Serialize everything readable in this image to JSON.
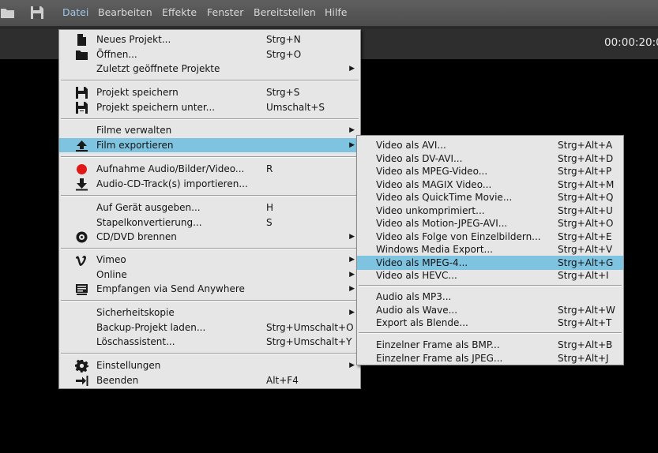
{
  "menubar": {
    "items": [
      "Datei",
      "Bearbeiten",
      "Effekte",
      "Fenster",
      "Bereitstellen",
      "Hilfe"
    ],
    "active_color": "#9fc7ea"
  },
  "timecode": "00:00:20:0",
  "file_menu": {
    "rows": [
      {
        "label": "Neues Projekt...",
        "shortcut": "Strg+N",
        "icon": "new-document-icon"
      },
      {
        "label": "Öffnen...",
        "shortcut": "Strg+O",
        "icon": "folder-icon"
      },
      {
        "label": "Zuletzt geöffnete Projekte",
        "submenu": true
      },
      {
        "label": "Projekt speichern",
        "shortcut": "Strg+S",
        "icon": "save-icon"
      },
      {
        "label": "Projekt speichern unter...",
        "shortcut": "Umschalt+S",
        "icon": "save-as-icon"
      },
      {
        "label": "Filme verwalten",
        "submenu": true
      },
      {
        "label": "Film exportieren",
        "submenu": true,
        "icon": "export-upload-icon",
        "highlighted": true
      },
      {
        "label": "Aufnahme Audio/Bilder/Video...",
        "shortcut": "R",
        "icon": "record-icon"
      },
      {
        "label": "Audio-CD-Track(s) importieren...",
        "icon": "download-import-icon"
      },
      {
        "label": "Auf Gerät ausgeben...",
        "shortcut": "H"
      },
      {
        "label": "Stapelkonvertierung...",
        "shortcut": "S"
      },
      {
        "label": "CD/DVD brennen",
        "submenu": true,
        "icon": "disc-icon"
      },
      {
        "label": "Vimeo",
        "submenu": true,
        "icon": "vimeo-icon"
      },
      {
        "label": "Online",
        "submenu": true
      },
      {
        "label": "Empfangen via Send Anywhere",
        "submenu": true,
        "icon": "send-anywhere-icon"
      },
      {
        "label": "Sicherheitskopie",
        "submenu": true
      },
      {
        "label": "Backup-Projekt laden...",
        "shortcut": "Strg+Umschalt+O"
      },
      {
        "label": "Löschassistent...",
        "shortcut": "Strg+Umschalt+Y"
      },
      {
        "label": "Einstellungen",
        "submenu": true,
        "icon": "gear-icon"
      },
      {
        "label": "Beenden",
        "shortcut": "Alt+F4",
        "icon": "exit-icon"
      }
    ]
  },
  "export_menu": {
    "rows": [
      {
        "label": "Video als AVI...",
        "shortcut": "Strg+Alt+A"
      },
      {
        "label": "Video als DV-AVI...",
        "shortcut": "Strg+Alt+D"
      },
      {
        "label": "Video als MPEG-Video...",
        "shortcut": "Strg+Alt+P"
      },
      {
        "label": "Video als MAGIX Video...",
        "shortcut": "Strg+Alt+M"
      },
      {
        "label": "Video als QuickTime Movie...",
        "shortcut": "Strg+Alt+Q"
      },
      {
        "label": "Video unkomprimiert...",
        "shortcut": "Strg+Alt+U"
      },
      {
        "label": "Video als Motion-JPEG-AVI...",
        "shortcut": "Strg+Alt+O"
      },
      {
        "label": "Video als Folge von Einzelbildern...",
        "shortcut": "Strg+Alt+E"
      },
      {
        "label": "Windows Media Export...",
        "shortcut": "Strg+Alt+V"
      },
      {
        "label": "Video als MPEG-4...",
        "shortcut": "Strg+Alt+G",
        "highlighted": true
      },
      {
        "label": "Video als HEVC...",
        "shortcut": "Strg+Alt+I"
      },
      {
        "label": "Audio als MP3..."
      },
      {
        "label": "Audio als Wave...",
        "shortcut": "Strg+Alt+W"
      },
      {
        "label": "Export als Blende...",
        "shortcut": "Strg+Alt+T"
      },
      {
        "label": "Einzelner Frame als BMP...",
        "shortcut": "Strg+Alt+B"
      },
      {
        "label": "Einzelner Frame als JPEG...",
        "shortcut": "Strg+Alt+J"
      }
    ]
  },
  "colors": {
    "highlight": "#7ec4e0",
    "menu_bg": "#e6e6e6",
    "record": "#e01818"
  }
}
